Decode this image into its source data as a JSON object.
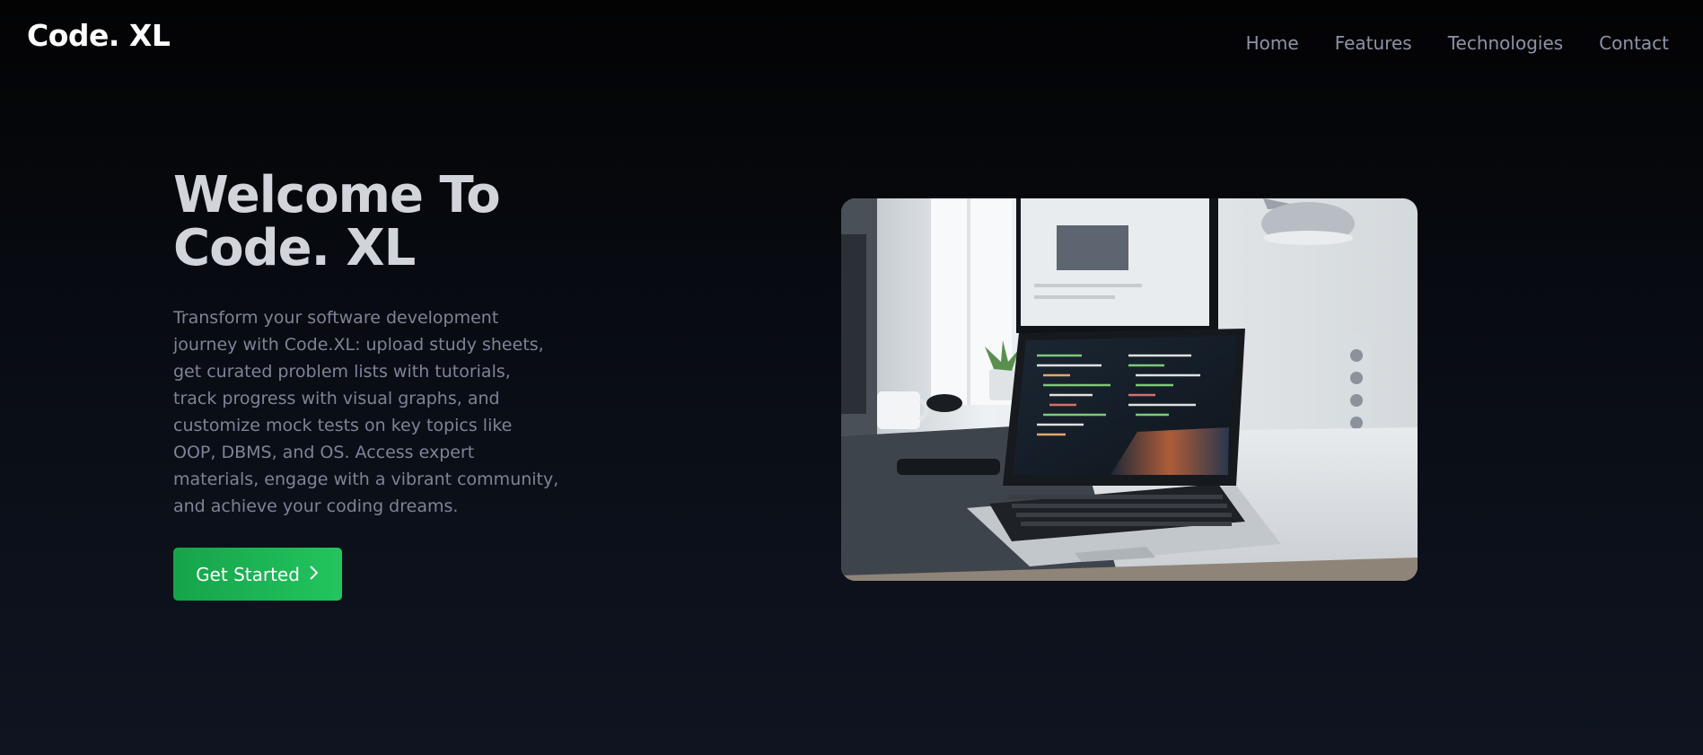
{
  "brand": {
    "name": "Code. XL"
  },
  "nav": {
    "items": [
      {
        "label": "Home"
      },
      {
        "label": "Features"
      },
      {
        "label": "Technologies"
      },
      {
        "label": "Contact"
      }
    ]
  },
  "hero": {
    "title_line1": "Welcome To",
    "title_line2": "Code. XL",
    "description": "Transform your software development journey with Code.XL: upload study sheets, get curated problem lists with tutorials, track progress with visual graphs, and customize mock tests on key topics like OOP, DBMS, and OS. Access expert materials, engage with a vibrant community, and achieve your coding dreams.",
    "cta_label": "Get Started",
    "cta_icon": "chevron-right-icon"
  },
  "colors": {
    "background": "#0c111b",
    "accent": "#22c55e",
    "accent_dark": "#16a34a",
    "title": "#d1d5db",
    "muted": "#7d8496",
    "nav": "#8b93a7"
  }
}
